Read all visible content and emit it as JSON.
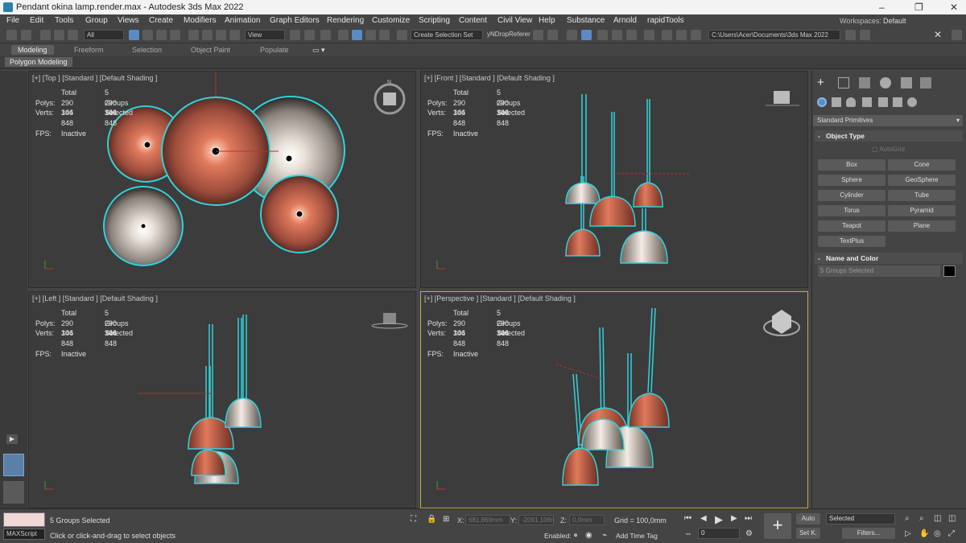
{
  "window": {
    "title": "Pendant okina lamp.render.max - Autodesk 3ds Max 2022",
    "minimize": "–",
    "restore": "❐",
    "close": "✕"
  },
  "menu": [
    "File",
    "Edit",
    "Tools",
    "Group",
    "Views",
    "Create",
    "Modifiers",
    "Animation",
    "Graph Editors",
    "Rendering",
    "Customize",
    "Scripting",
    "Content",
    "Civil View",
    "Help",
    "Substance",
    "Arnold",
    "rapidTools"
  ],
  "workspaces": {
    "label": "Workspaces:",
    "value": "Default"
  },
  "toolbar": {
    "filter": "All",
    "refcoord": "View",
    "selection_set": "Create Selection Set",
    "named_ref": "yNDropReferer",
    "path": "C:\\Users\\Acer\\Documents\\3ds Max 2022"
  },
  "ribbon": {
    "tabs": [
      "Modeling",
      "Freeform",
      "Selection",
      "Object Paint",
      "Populate"
    ],
    "sub": "Polygon Modeling"
  },
  "stats": {
    "total": "Total",
    "groups": "5 Groups Selected",
    "polys_label": "Polys:",
    "polys_total": "290 304",
    "polys_sel": "290 304",
    "verts_label": "Verts:",
    "verts_total": "146 848",
    "verts_sel": "146 848",
    "fps_label": "FPS:",
    "fps_value": "Inactive"
  },
  "viewports": {
    "top": "[+] [Top ] [Standard ] [Default Shading ]",
    "front": "[+] [Front ] [Standard ] [Default Shading ]",
    "left": "[+] [Left ] [Standard ] [Default Shading ]",
    "perspective": "[+] [Perspective ] [Standard ] [Default Shading ]"
  },
  "command_panel": {
    "category": "Standard Primitives",
    "object_type_header": "Object Type",
    "autogrid": "AutoGrid",
    "buttons": [
      "Box",
      "Cone",
      "Sphere",
      "GeoSphere",
      "Cylinder",
      "Tube",
      "Torus",
      "Pyramid",
      "Teapot",
      "Plane",
      "TextPlus"
    ],
    "name_color_header": "Name and Color",
    "name_value": "5 Groups Selected",
    "swatch_color": "#000000"
  },
  "status": {
    "maxscript": "MAXScript",
    "selected": "5 Groups Selected",
    "prompt": "Click or click-and-drag to select objects",
    "x_label": "X:",
    "x_value": "681,869mm",
    "y_label": "Y:",
    "y_value": "-2091,106n",
    "z_label": "Z:",
    "z_value": "0,0mm",
    "grid": "Grid = 100,0mm",
    "enabled": "Enabled:",
    "add_time_tag": "Add Time Tag",
    "auto": "Auto",
    "selected_dd": "Selected",
    "set_key": "Set K.",
    "filters": "Filters...",
    "frame": "0"
  },
  "colors": {
    "accent": "#5a8bc6",
    "lamp_copper": "#b85a42",
    "selection": "#2fd3dc",
    "active_border": "#c5a94a"
  }
}
